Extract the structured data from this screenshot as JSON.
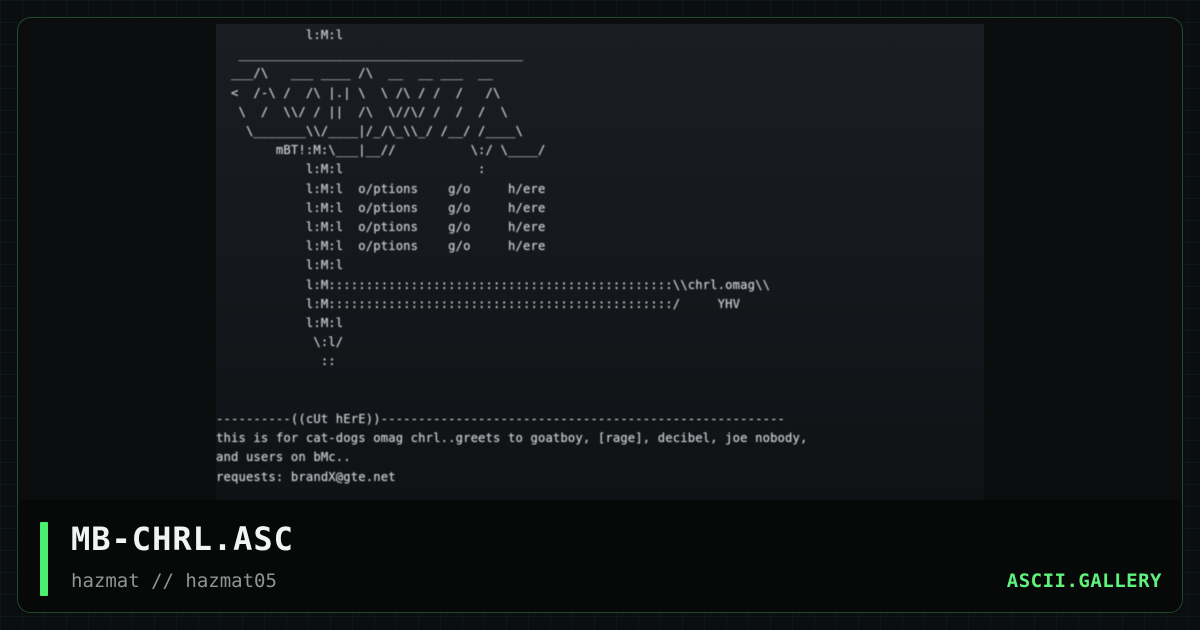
{
  "artwork": {
    "ascii_lines": [
      "            l:M:l",
      "   ______________________________________",
      "  ___/\\   ___ ____ /\\  __  __ ___  __",
      "  <  /-\\ /  /\\ |.| \\  \\ /\\ / /  /   /\\",
      "   \\  /  \\\\/ / ||  /\\  \\//\\/ /  /  /  \\",
      "    \\_______\\\\/____|/_/\\_\\\\_/ /__/ /____\\",
      "        mBT!:M:\\___|__//          \\:/ \\____/",
      "            l:M:l                  :",
      "            l:M:l  o/ptions    g/o     h/ere",
      "            l:M:l  o/ptions    g/o     h/ere",
      "            l:M:l  o/ptions    g/o     h/ere",
      "            l:M:l  o/ptions    g/o     h/ere",
      "            l:M:l",
      "            l:M::::::::::::::::::::::::::::::::::::::::::::::\\\\chrl.omag\\\\",
      "            l:M::::::::::::::::::::::::::::::::::::::::::::::/     YHV",
      "            l:M:l",
      "             \\:l/",
      "              ::",
      "",
      "",
      "----------((cUt hErE))------------------------------------------------------",
      "this is for cat-dogs omag chrl..greets to goatboy, [rage], decibel, joe nobody,",
      "and users on bMc..",
      "requests: brandX@gte.net"
    ]
  },
  "footer": {
    "title": "MB-CHRL.ASC",
    "author": "hazmat // hazmat05",
    "brand": "ASCII.GALLERY"
  },
  "colors": {
    "accent": "#4cf06f",
    "brand": "#5ff27c",
    "border": "#1f4a2b",
    "title": "#f2f4f3",
    "muted": "#8e9694",
    "ascii_text": "#c9cbcf",
    "preview_bg": "#1a1d22"
  }
}
